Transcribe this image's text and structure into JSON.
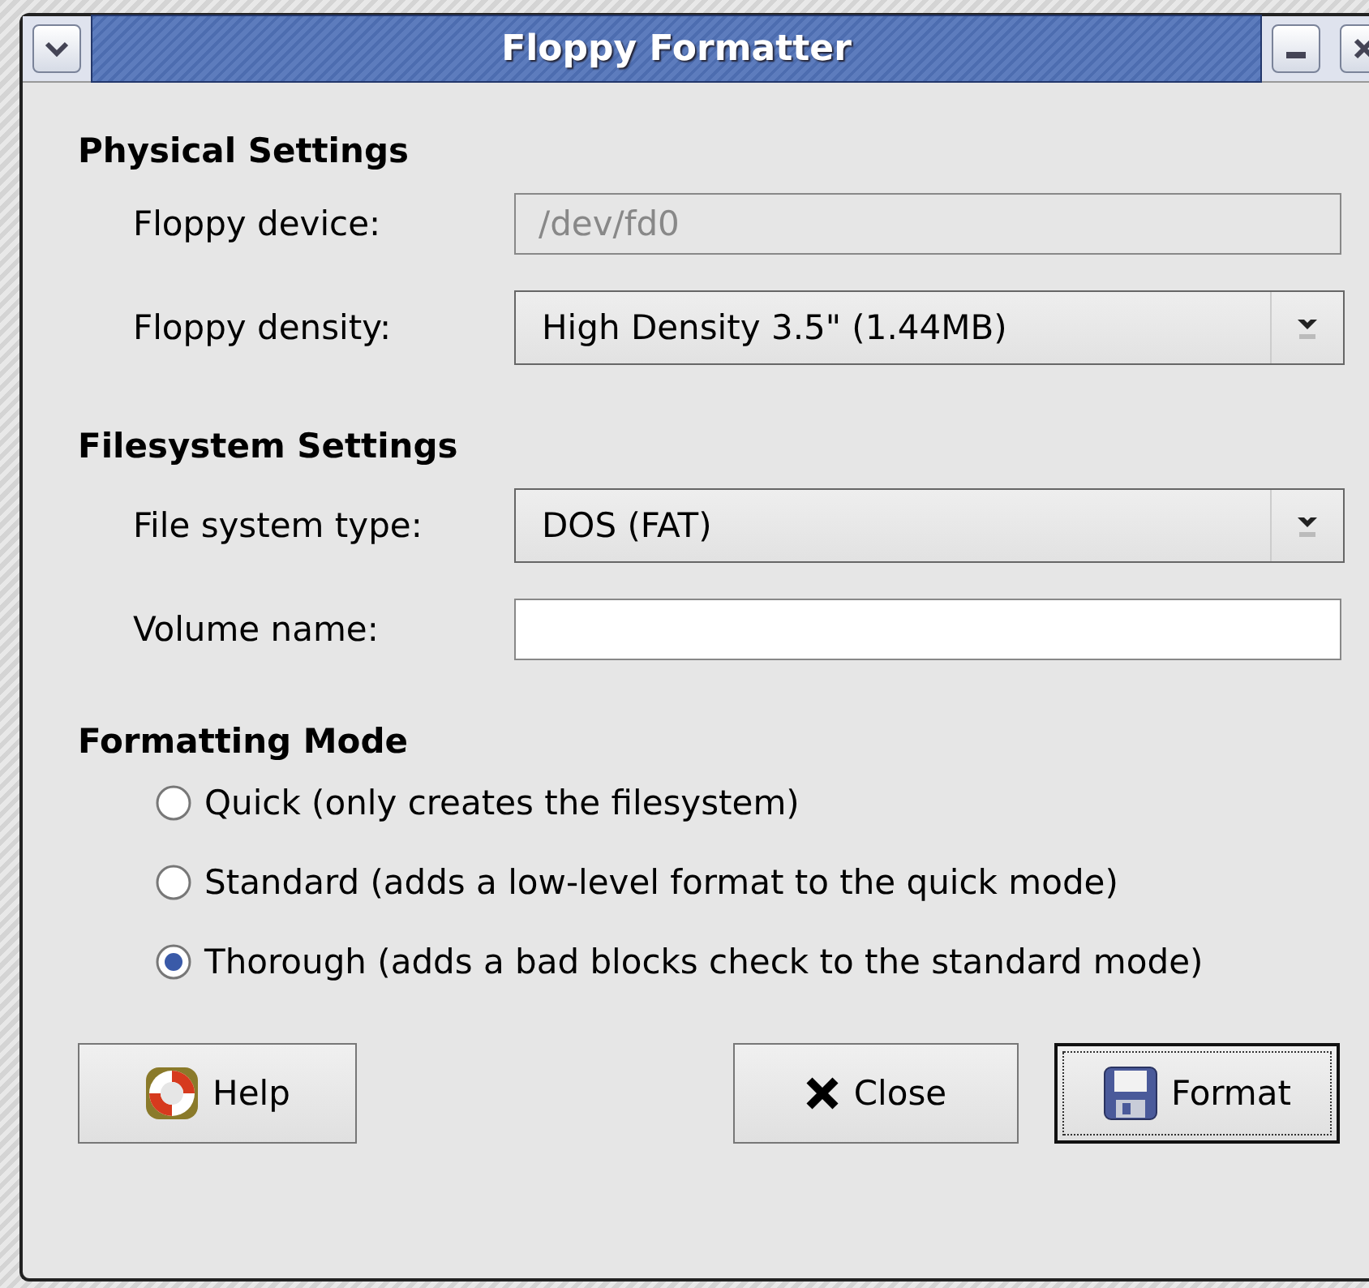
{
  "window": {
    "title": "Floppy Formatter"
  },
  "sections": [
    {
      "title": "Physical Settings",
      "fields": [
        {
          "kind": "entry",
          "label": "Floppy device:",
          "value": "/dev/fd0",
          "disabled": true
        },
        {
          "kind": "combo",
          "label": "Floppy density:",
          "value": "High Density 3.5\" (1.44MB)"
        }
      ]
    },
    {
      "title": "Filesystem Settings",
      "fields": [
        {
          "kind": "combo",
          "label": "File system type:",
          "value": "DOS (FAT)"
        },
        {
          "kind": "entry",
          "label": "Volume name:",
          "disabled": false
        }
      ]
    }
  ],
  "formatting_mode": {
    "title": "Formatting Mode",
    "options": [
      {
        "label": "Quick (only creates the filesystem)",
        "selected": false
      },
      {
        "label": "Standard (adds a low-level format to the quick mode)",
        "selected": false
      },
      {
        "label": "Thorough (adds a bad blocks check to the standard mode)",
        "selected": true
      }
    ]
  },
  "buttons": [
    {
      "kind": "help",
      "label": "Help",
      "focused": false
    },
    {
      "kind": "close",
      "label": "Close",
      "focused": false
    },
    {
      "kind": "format",
      "label": "Format",
      "focused": true
    }
  ]
}
